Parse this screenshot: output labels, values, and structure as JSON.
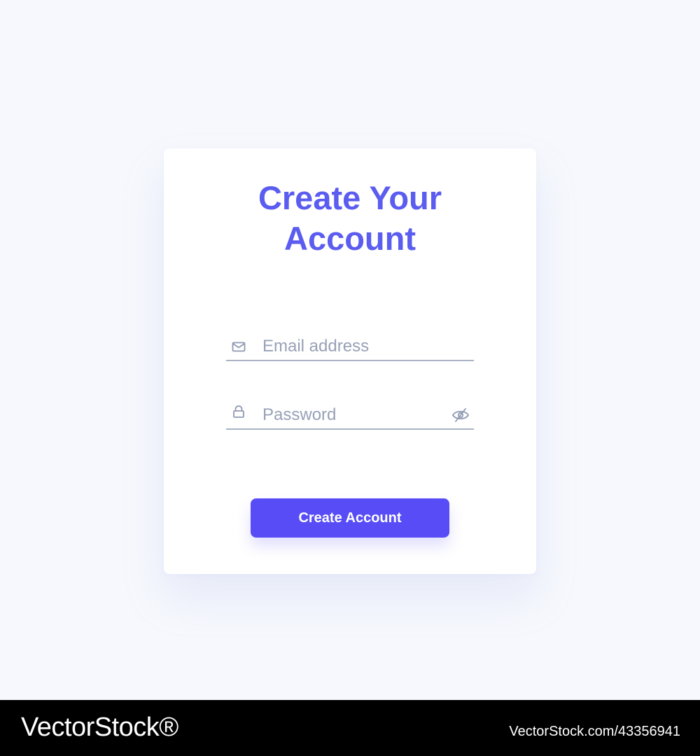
{
  "form": {
    "title_line1": "Create Your",
    "title_line2": "Account",
    "email": {
      "placeholder": "Email address",
      "value": "",
      "icon": "mail-icon"
    },
    "password": {
      "placeholder": "Password",
      "value": "",
      "icon": "lock-icon",
      "toggle_icon": "eye-slash-icon"
    },
    "submit_label": "Create Account"
  },
  "footer": {
    "logo_text": "VectorStock®",
    "image_id": "VectorStock.com/43356941"
  },
  "colors": {
    "background": "#f6f8fd",
    "card": "#ffffff",
    "accent": "#5b5cf0",
    "button": "#574cf6",
    "field_line": "#a9b2c7",
    "placeholder": "#97a1b7",
    "footer": "#000000"
  }
}
